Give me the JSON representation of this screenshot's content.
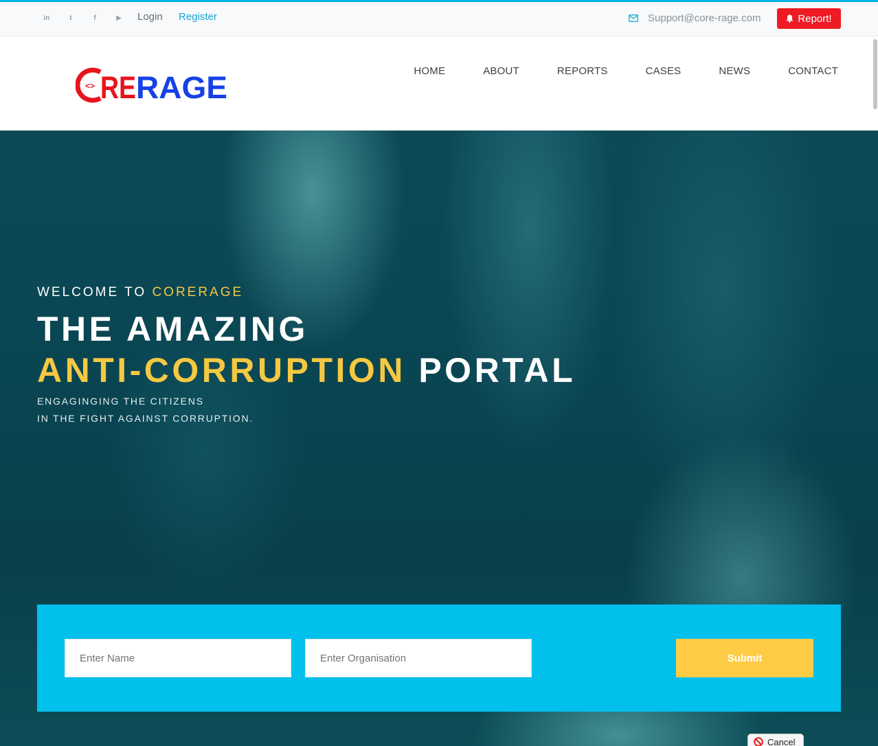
{
  "topbar": {
    "social": [
      {
        "name": "linkedin-icon",
        "glyph": "in"
      },
      {
        "name": "twitter-icon",
        "glyph": "t"
      },
      {
        "name": "facebook-icon",
        "glyph": "f"
      },
      {
        "name": "youtube-icon",
        "glyph": "▶"
      }
    ],
    "login_label": "Login",
    "register_label": "Register",
    "support_email": "Support@core-rage.com",
    "report_label": "Report!"
  },
  "header": {
    "logo": {
      "part_red": "RE",
      "part_blue": "RAGE",
      "brand_red": "#e8141c",
      "brand_blue": "#1641e6"
    },
    "nav": [
      "HOME",
      "ABOUT",
      "REPORTS",
      "CASES",
      "NEWS",
      "CONTACT"
    ]
  },
  "hero": {
    "welcome_prefix": "WELCOME TO",
    "welcome_brand": "CORERAGE",
    "headline_line1": "THE AMAZING",
    "headline_accent": "ANTI-CORRUPTION",
    "headline_rest": "PORTAL",
    "sub_line1": "ENGAGINGING THE CITIZENS",
    "sub_line2": "IN THE FIGHT AGAINST CORRUPTION."
  },
  "form": {
    "name_placeholder": "Enter Name",
    "org_placeholder": "Enter Organisation",
    "submit_label": "Submit"
  },
  "cancel_label": "Cancel",
  "colors": {
    "accent": "#f5c842",
    "form_band": "#02c0ec",
    "submit": "#fecb45",
    "report": "#ee1b24",
    "link": "#19a6d6"
  }
}
